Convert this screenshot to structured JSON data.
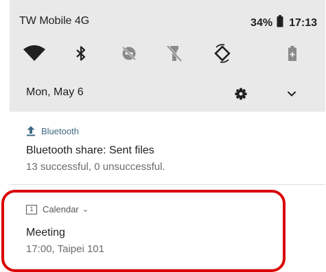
{
  "status_bar": {
    "carrier": "TW Mobile 4G",
    "battery": "34%",
    "time": "17:13"
  },
  "quick_settings": [
    {
      "icon": "wifi-icon",
      "state": "on"
    },
    {
      "icon": "bluetooth-icon",
      "state": "on"
    },
    {
      "icon": "do-not-disturb-icon",
      "state": "off"
    },
    {
      "icon": "flashlight-icon",
      "state": "off"
    },
    {
      "icon": "auto-rotate-icon",
      "state": "on"
    },
    {
      "icon": "battery-saver-icon",
      "state": "off"
    }
  ],
  "header": {
    "date": "Mon, May 6",
    "settings_icon": "gear-icon",
    "expand_icon": "chevron-down-icon"
  },
  "notifications": [
    {
      "app": "Bluetooth",
      "icon": "upload-arrow-icon",
      "title": "Bluetooth share: Sent files",
      "text": "13 successful, 0 unsuccessful."
    },
    {
      "app": "Calendar",
      "icon": "calendar-icon",
      "icon_text": "1",
      "expand_chevron": "⌄",
      "title": "Meeting",
      "text": "17:00, Taipei 101"
    }
  ],
  "colors": {
    "shade_background": "#e9e9e9",
    "card_background": "#ffffff",
    "active_icon": "#202020",
    "inactive_icon": "#8a8a8a",
    "bluetooth_app_accent": "#3f6a83",
    "highlight": "#d90000"
  }
}
